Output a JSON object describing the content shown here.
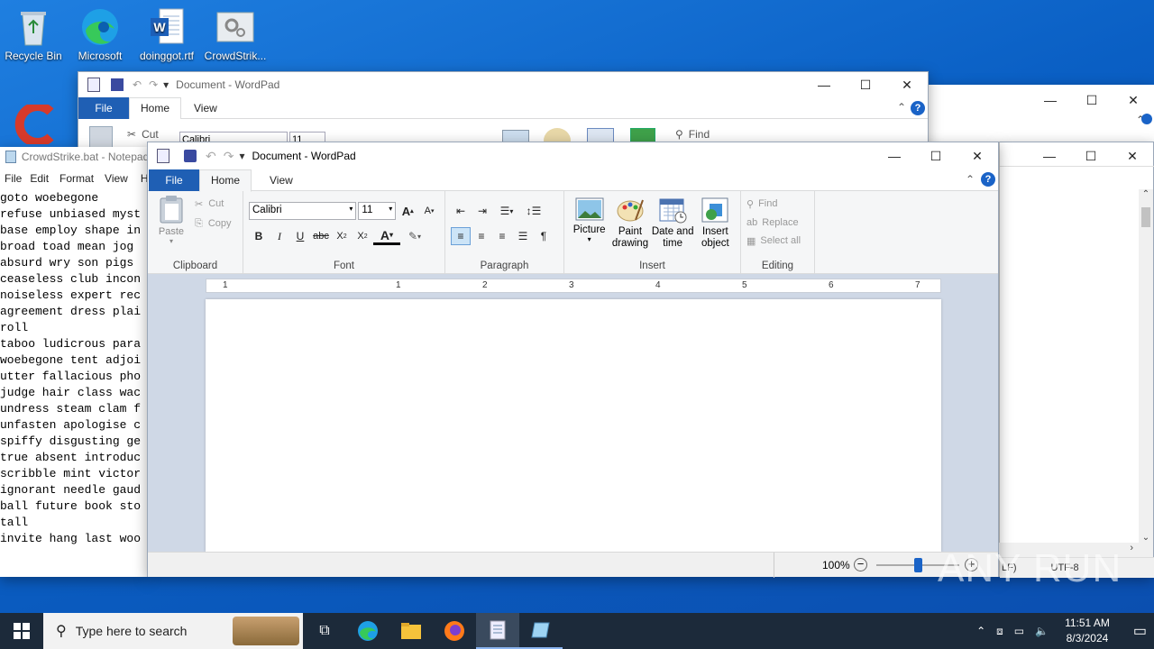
{
  "desktop": {
    "icons": [
      {
        "label": "Recycle Bin",
        "icon": "recycle-bin-icon"
      },
      {
        "label": "Microsoft Edge",
        "icon": "edge-icon"
      },
      {
        "label": "doinggot.rtf",
        "icon": "word-document-icon"
      },
      {
        "label": "CrowdStrik...",
        "icon": "settings-file-icon"
      }
    ]
  },
  "wordpad_back": {
    "title": "Document - WordPad",
    "tabs": [
      "File",
      "Home",
      "View"
    ],
    "font_name": "Calibri",
    "font_size": "11",
    "cut": "Cut",
    "find": "Find"
  },
  "notepad": {
    "title": "CrowdStrike.bat - Notepad",
    "menu": [
      "File",
      "Edit",
      "Format",
      "View",
      "H"
    ],
    "lines": [
      "goto woebegone",
      "refuse unbiased myst",
      "base employ shape in",
      "broad toad mean jog",
      "absurd wry son pigs",
      "ceaseless club incon",
      "noiseless expert rec",
      "agreement dress plai",
      "roll",
      "taboo ludicrous para",
      "woebegone tent adjoi",
      "utter fallacious pho",
      "judge hair class wac",
      "undress steam clam f",
      "unfasten apologise c",
      "spiffy disgusting ge",
      "true absent introduc",
      "scribble mint victor",
      "ignorant needle gaud",
      "ball future book sto",
      "tall",
      "invite hang last woo"
    ],
    "status_encoding": "UTF-8",
    "status_lf": "LF)"
  },
  "wordpad": {
    "title": "Document - WordPad",
    "tabs": {
      "file": "File",
      "home": "Home",
      "view": "View"
    },
    "clipboard": {
      "paste": "Paste",
      "cut": "Cut",
      "copy": "Copy",
      "label": "Clipboard"
    },
    "font": {
      "name": "Calibri",
      "size": "11",
      "label": "Font"
    },
    "paragraph": {
      "label": "Paragraph"
    },
    "insert": {
      "picture": "Picture",
      "paint": "Paint drawing",
      "datetime": "Date and time",
      "object": "Insert object",
      "label": "Insert"
    },
    "editing": {
      "find": "Find",
      "replace": "Replace",
      "select_all": "Select all",
      "label": "Editing"
    },
    "ruler": [
      "1",
      "1",
      "2",
      "3",
      "4",
      "5",
      "6",
      "7"
    ],
    "zoom": "100%",
    "zoom_level": 0.5
  },
  "taskbar": {
    "search_placeholder": "Type here to search",
    "time": "11:51 AM",
    "date": "8/3/2024"
  },
  "watermark": "ANY RUN"
}
